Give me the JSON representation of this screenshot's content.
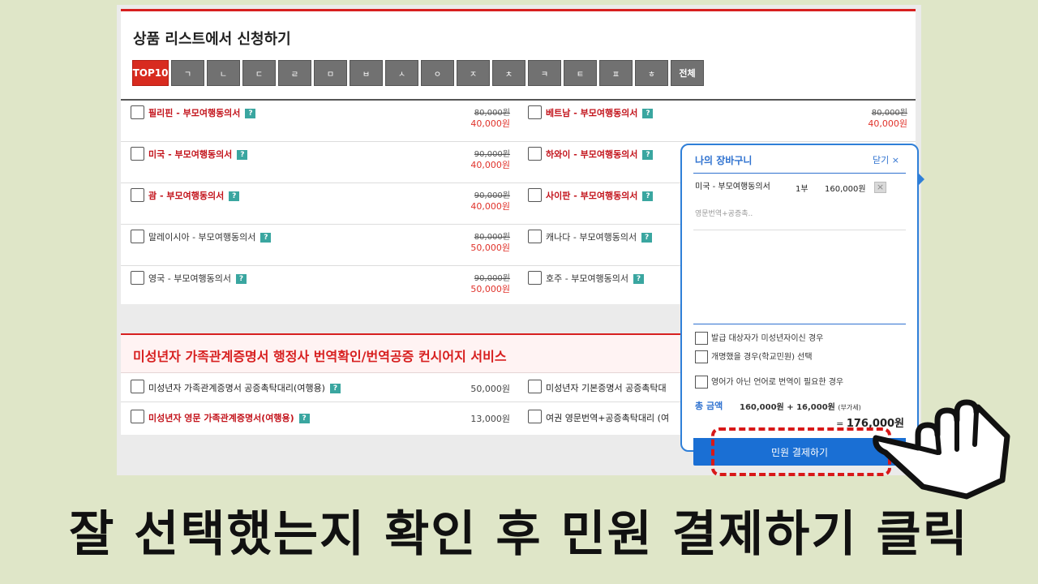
{
  "section1": {
    "title": "상품 리스트에서 신청하기",
    "tabs": [
      "TOP10",
      "ㄱ",
      "ㄴ",
      "ㄷ",
      "ㄹ",
      "ㅁ",
      "ㅂ",
      "ㅅ",
      "ㅇ",
      "ㅈ",
      "ㅊ",
      "ㅋ",
      "ㅌ",
      "ㅍ",
      "ㅎ",
      "전체"
    ],
    "rows": [
      {
        "left": {
          "name": "필리핀 - 부모여행동의서",
          "old": "80,000원",
          "new": "40,000원"
        },
        "right": {
          "name": "베트남 - 부모여행동의서",
          "old": "80,000원",
          "new": "40,000원"
        }
      },
      {
        "left": {
          "name": "미국 - 부모여행동의서",
          "old": "90,000원",
          "new": "40,000원"
        },
        "right": {
          "name": "하와이 - 부모여행동의서",
          "old": "",
          "new": ""
        }
      },
      {
        "left": {
          "name": "괌 - 부모여행동의서",
          "old": "90,000원",
          "new": "40,000원"
        },
        "right": {
          "name": "사이판 - 부모여행동의서",
          "old": "",
          "new": ""
        }
      },
      {
        "left": {
          "name": "말레이시아 - 부모여행동의서",
          "old": "80,000원",
          "new": "50,000원"
        },
        "right": {
          "name": "캐나다 - 부모여행동의서",
          "old": "",
          "new": ""
        }
      },
      {
        "left": {
          "name": "영국 - 부모여행동의서",
          "old": "90,000원",
          "new": "50,000원"
        },
        "right": {
          "name": "호주 - 부모여행동의서",
          "old": "",
          "new": ""
        }
      }
    ]
  },
  "section2": {
    "title": "미성년자 가족관계증명서 행정사 번역확인/번역공증 컨시어지 서비스",
    "rows": [
      {
        "left": {
          "name": "미성년자 가족관계증명서 공증촉탁대리(여행용)",
          "price": "50,000원"
        },
        "right": {
          "name": "미성년자 기본증명서 공증촉탁대"
        }
      },
      {
        "left": {
          "name": "미성년자 영문 가족관계증명서(여행용)",
          "price": "13,000원"
        },
        "right": {
          "name": "여권 영문번역+공증촉탁대리 (여"
        }
      }
    ]
  },
  "q_mark": "?",
  "cart": {
    "title": "나의 장바구니",
    "close": "닫기 ×",
    "item": {
      "name": "미국 - 부모여행동의서",
      "qty": "1부",
      "price": "160,000원",
      "sub": "영문번역+공증촉..",
      "delete": "×"
    },
    "options": [
      "발급 대상자가 미성년자이신 경우",
      "개명했을 경우(학교민원) 선택",
      "영어가 아닌 언어로 번역이 필요한 경우"
    ],
    "total_label": "총 금액",
    "total_calc": "160,000원 + 16,000원",
    "vat": "(부가세)",
    "total_eq_prefix": "=",
    "total": "176,000원",
    "pay_button": "민원 결제하기"
  },
  "caption": "잘 선택했는지 확인 후 민원 결제하기 클릭",
  "colors": {
    "accent_red": "#d71f1f",
    "accent_blue": "#1a6fd4",
    "background": "#dfe6c8"
  }
}
